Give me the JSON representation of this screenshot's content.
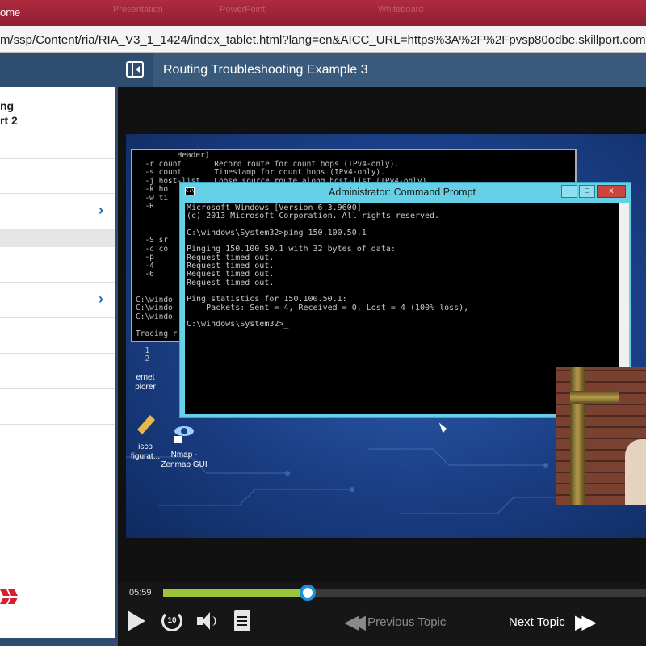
{
  "browser": {
    "title_fragment": "ome",
    "ghost_tabs": [
      "Presentation",
      "PowerPoint",
      "Whiteboard"
    ],
    "url": "m/ssp/Content/ria/RIA_V3_1_1424/index_tablet.html?lang=en&AICC_URL=https%3A%2F%2Fpvsp80odbe.skillport.com"
  },
  "sidebar": {
    "course_title_lines": [
      "ng",
      "rt 2"
    ],
    "logo_icon": "skillsoft-logo"
  },
  "topic": {
    "title": "Routing Troubleshooting Example 3"
  },
  "video": {
    "background_console": "         Header).\n  -r count       Record route for count hops (IPv4-only).\n  -s count       Timestamp for count hops (IPv4-only).\n  -j host-list   Loose source route along host-list (IPv4-only).\n  -k ho\n  -w ti\n  -R\n\n\n\n  -S sr\n  -c co\n  -p\n  -4\n  -6\n\n\nC:\\windo\nC:\\windo\nC:\\windo\n\nTracing r\n\n  1     \n  2     ",
    "cmd_window_title": "Administrator: Command Prompt",
    "cmd_icon_label": "C:\\",
    "cmd_output": "Microsoft Windows [Version 6.3.9600]\n(c) 2013 Microsoft Corporation. All rights reserved.\n\nC:\\windows\\System32>ping 150.100.50.1\n\nPinging 150.100.50.1 with 32 bytes of data:\nRequest timed out.\nRequest timed out.\nRequest timed out.\nRequest timed out.\n\nPing statistics for 150.100.50.1:\n    Packets: Sent = 4, Received = 0, Lost = 4 (100% loss),\n\nC:\\windows\\System32>_",
    "desktop_icons": [
      {
        "label_line1": "ernet",
        "label_line2": "plorer"
      },
      {
        "label_line1": "isco",
        "label_line2": "figurat..."
      },
      {
        "label_line1": "Nmap -",
        "label_line2": "Zenmap GUI"
      }
    ]
  },
  "controls": {
    "elapsed": "05:59",
    "progress_fraction": 0.3,
    "replay_label": "10",
    "previous_label": "Previous Topic",
    "next_label": "Next Topic"
  },
  "colors": {
    "accent_blue": "#1c8fd6",
    "progress_green": "#9bc43c",
    "sidebar_navy": "#2f4d6e",
    "browser_red": "#b12a3e"
  }
}
